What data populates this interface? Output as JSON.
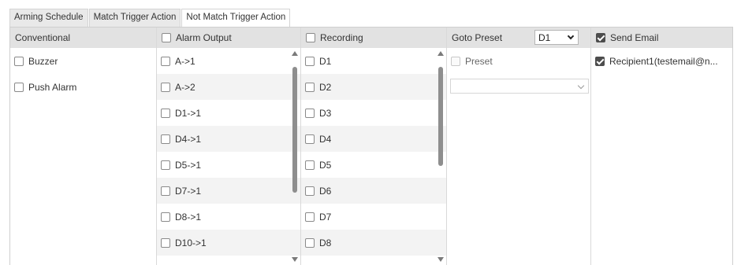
{
  "tabs": [
    {
      "label": "Arming Schedule",
      "active": false
    },
    {
      "label": "Match Trigger Action",
      "active": false
    },
    {
      "label": "Not Match Trigger Action",
      "active": true
    }
  ],
  "conventional": {
    "header": "Conventional",
    "items": [
      {
        "label": "Buzzer",
        "checked": false
      },
      {
        "label": "Push Alarm",
        "checked": false
      }
    ]
  },
  "alarm_output": {
    "header": "Alarm Output",
    "header_checked": false,
    "items": [
      {
        "label": "A->1",
        "checked": false
      },
      {
        "label": "A->2",
        "checked": false
      },
      {
        "label": "D1->1",
        "checked": false
      },
      {
        "label": "D4->1",
        "checked": false
      },
      {
        "label": "D5->1",
        "checked": false
      },
      {
        "label": "D7->1",
        "checked": false
      },
      {
        "label": "D8->1",
        "checked": false
      },
      {
        "label": "D10->1",
        "checked": false
      }
    ]
  },
  "recording": {
    "header": "Recording",
    "header_checked": false,
    "items": [
      {
        "label": "D1",
        "checked": false
      },
      {
        "label": "D2",
        "checked": false
      },
      {
        "label": "D3",
        "checked": false
      },
      {
        "label": "D4",
        "checked": false
      },
      {
        "label": "D5",
        "checked": false
      },
      {
        "label": "D6",
        "checked": false
      },
      {
        "label": "D7",
        "checked": false
      },
      {
        "label": "D8",
        "checked": false
      }
    ]
  },
  "goto_preset": {
    "header": "Goto Preset",
    "channel_value": "D1",
    "preset_label": "Preset",
    "preset_checked": false,
    "preset_value": ""
  },
  "send_email": {
    "header": "Send Email",
    "header_checked": true,
    "items": [
      {
        "label": "Recipient1(testemail@n...",
        "checked": true
      }
    ]
  }
}
